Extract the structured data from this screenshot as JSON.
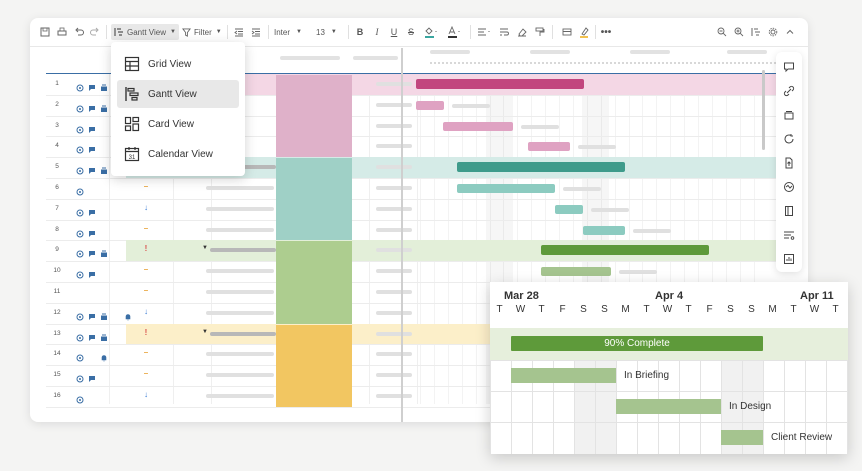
{
  "toolbar": {
    "view_label": "Gantt View",
    "filter_label": "Filter",
    "font_name": "Inter",
    "font_size": "13"
  },
  "view_menu": {
    "items": [
      {
        "label": "Grid View",
        "icon": "grid-view-icon"
      },
      {
        "label": "Gantt View",
        "icon": "gantt-view-icon",
        "active": true
      },
      {
        "label": "Card View",
        "icon": "card-view-icon"
      },
      {
        "label": "Calendar View",
        "icon": "calendar-view-icon",
        "icon_text": "31"
      }
    ]
  },
  "rows": [
    {
      "num": "1",
      "icons": [
        "comment",
        "chat",
        "stack"
      ]
    },
    {
      "num": "2",
      "icons": [
        "comment",
        "chat",
        "stack"
      ]
    },
    {
      "num": "3",
      "icons": [
        "comment",
        "chat"
      ]
    },
    {
      "num": "4",
      "icons": [
        "comment",
        "chat"
      ]
    },
    {
      "num": "5",
      "icons": [
        "comment",
        "chat",
        "stack"
      ]
    },
    {
      "num": "6",
      "icons": [
        "comment"
      ],
      "priority": "–",
      "priority_color": "#e8a640"
    },
    {
      "num": "7",
      "icons": [
        "comment",
        "chat"
      ],
      "priority": "↓",
      "priority_color": "#3a7bd5"
    },
    {
      "num": "8",
      "icons": [
        "comment",
        "chat"
      ],
      "priority": "–",
      "priority_color": "#e8a640"
    },
    {
      "num": "9",
      "icons": [
        "comment",
        "chat",
        "stack"
      ],
      "priority": "!",
      "priority_color": "#d9534f"
    },
    {
      "num": "10",
      "icons": [
        "comment",
        "chat"
      ],
      "priority": "–",
      "priority_color": "#e8a640"
    },
    {
      "num": "11",
      "icons": [],
      "priority": "–",
      "priority_color": "#e8a640"
    },
    {
      "num": "12",
      "icons": [
        "comment",
        "chat",
        "stack",
        "bell"
      ],
      "priority": "↓",
      "priority_color": "#3a7bd5"
    },
    {
      "num": "13",
      "icons": [
        "comment",
        "chat",
        "stack"
      ],
      "priority": "!",
      "priority_color": "#d9534f"
    },
    {
      "num": "14",
      "icons": [
        "comment",
        "bell"
      ],
      "priority": "–",
      "priority_color": "#e8a640"
    },
    {
      "num": "15",
      "icons": [
        "comment",
        "chat"
      ],
      "priority": "–",
      "priority_color": "#e8a640"
    },
    {
      "num": "16",
      "icons": [
        "comment"
      ],
      "priority": "↓",
      "priority_color": "#3a7bd5"
    }
  ],
  "zoom": {
    "date_labels": [
      "Mar 28",
      "Apr 4",
      "Apr 11"
    ],
    "days": [
      "T",
      "W",
      "T",
      "F",
      "S",
      "S",
      "M",
      "T",
      "W",
      "T",
      "F",
      "S",
      "S",
      "M",
      "T",
      "W",
      "T"
    ],
    "tasks": [
      {
        "label": "90% Complete",
        "progress": 0.9
      },
      {
        "label": "In Briefing"
      },
      {
        "label": "In Design"
      },
      {
        "label": "Client Review"
      }
    ]
  },
  "colors": {
    "pink": "#c2457e",
    "teal": "#3e9b8b",
    "green": "#5e9a3a",
    "yellow": "#f2c14e"
  }
}
